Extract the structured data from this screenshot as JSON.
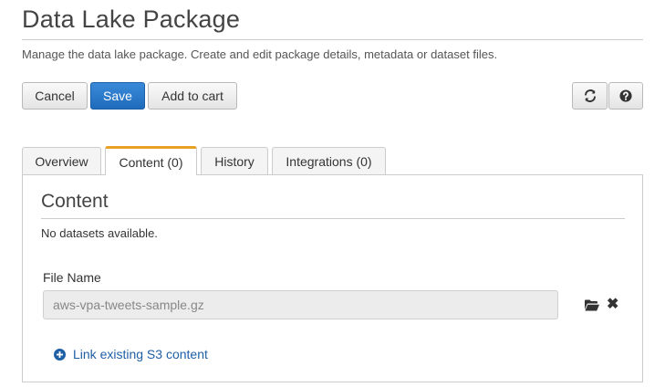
{
  "header": {
    "title": "Data Lake Package",
    "description": "Manage the data lake package. Create and edit package details, metadata or dataset files."
  },
  "toolbar": {
    "cancel_label": "Cancel",
    "save_label": "Save",
    "add_to_cart_label": "Add to cart",
    "refresh_icon": "refresh-icon",
    "help_icon": "question-circle-icon"
  },
  "tabs": [
    {
      "label": "Overview",
      "active": false
    },
    {
      "label": "Content (0)",
      "active": true
    },
    {
      "label": "History",
      "active": false
    },
    {
      "label": "Integrations (0)",
      "active": false
    }
  ],
  "content": {
    "section_title": "Content",
    "empty_message": "No datasets available.",
    "file_name_label": "File Name",
    "file_name_value": "aws-vpa-tweets-sample.gz",
    "link_s3_label": "Link existing S3 content"
  },
  "colors": {
    "primary_button": "#1f6bbd",
    "active_tab_accent": "#e8a025",
    "link": "#1f5fa6"
  }
}
